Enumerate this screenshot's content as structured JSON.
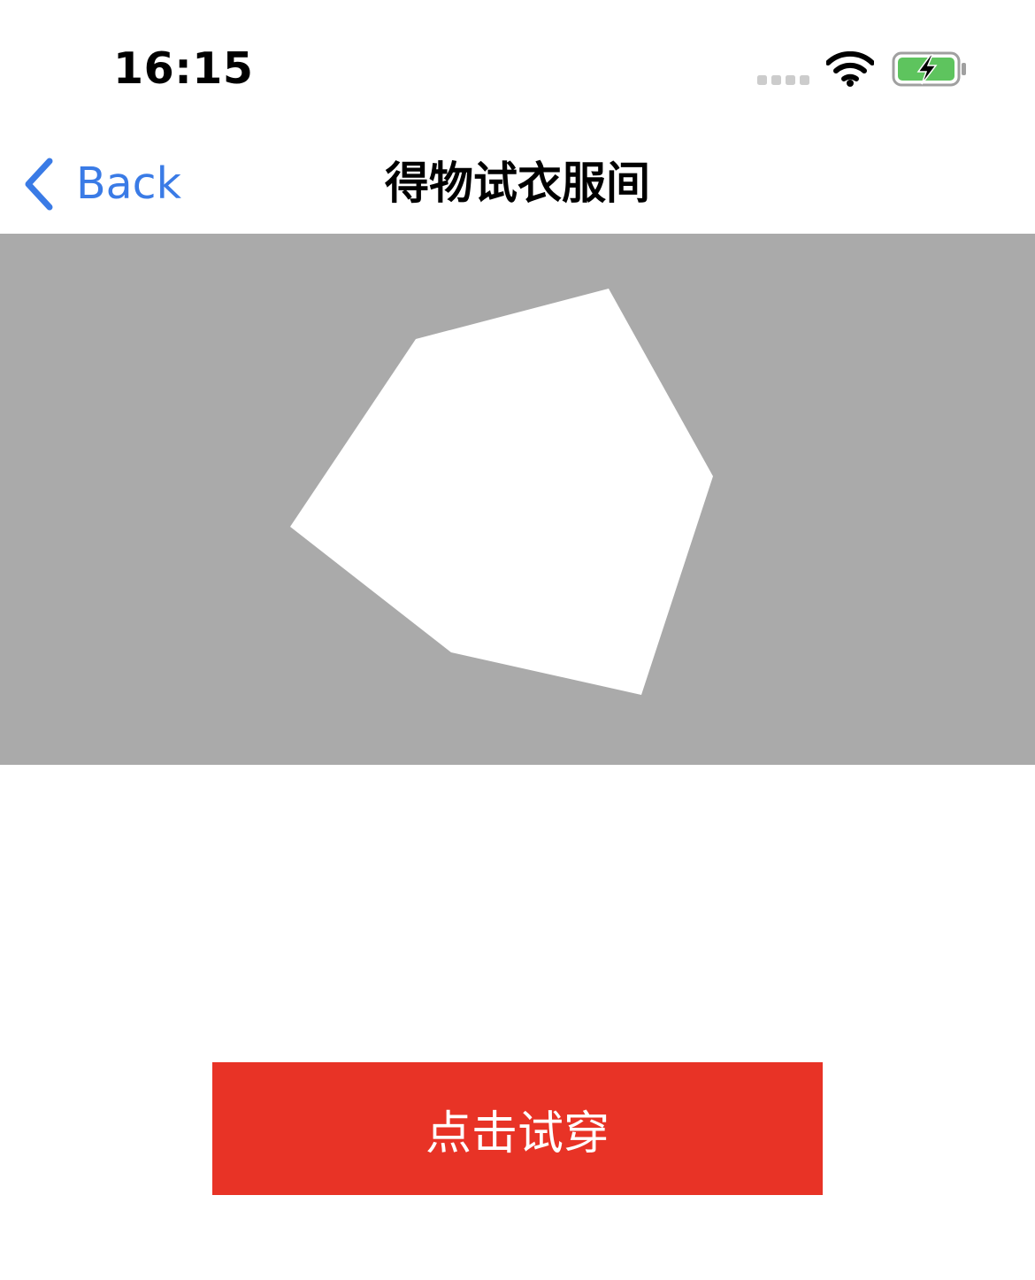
{
  "status_bar": {
    "time": "16:15",
    "wifi_icon": "wifi-icon",
    "battery_icon": "battery-charging-icon",
    "battery_color": "#5ec45e"
  },
  "nav": {
    "back_label": "Back",
    "back_icon": "chevron-left-icon",
    "title": "得物试衣服间",
    "accent_color": "#3a7be6"
  },
  "preview": {
    "background_color": "#aaaaaa",
    "shape_color": "#ffffff"
  },
  "action": {
    "try_on_label": "点击试穿",
    "button_color": "#e83326"
  }
}
